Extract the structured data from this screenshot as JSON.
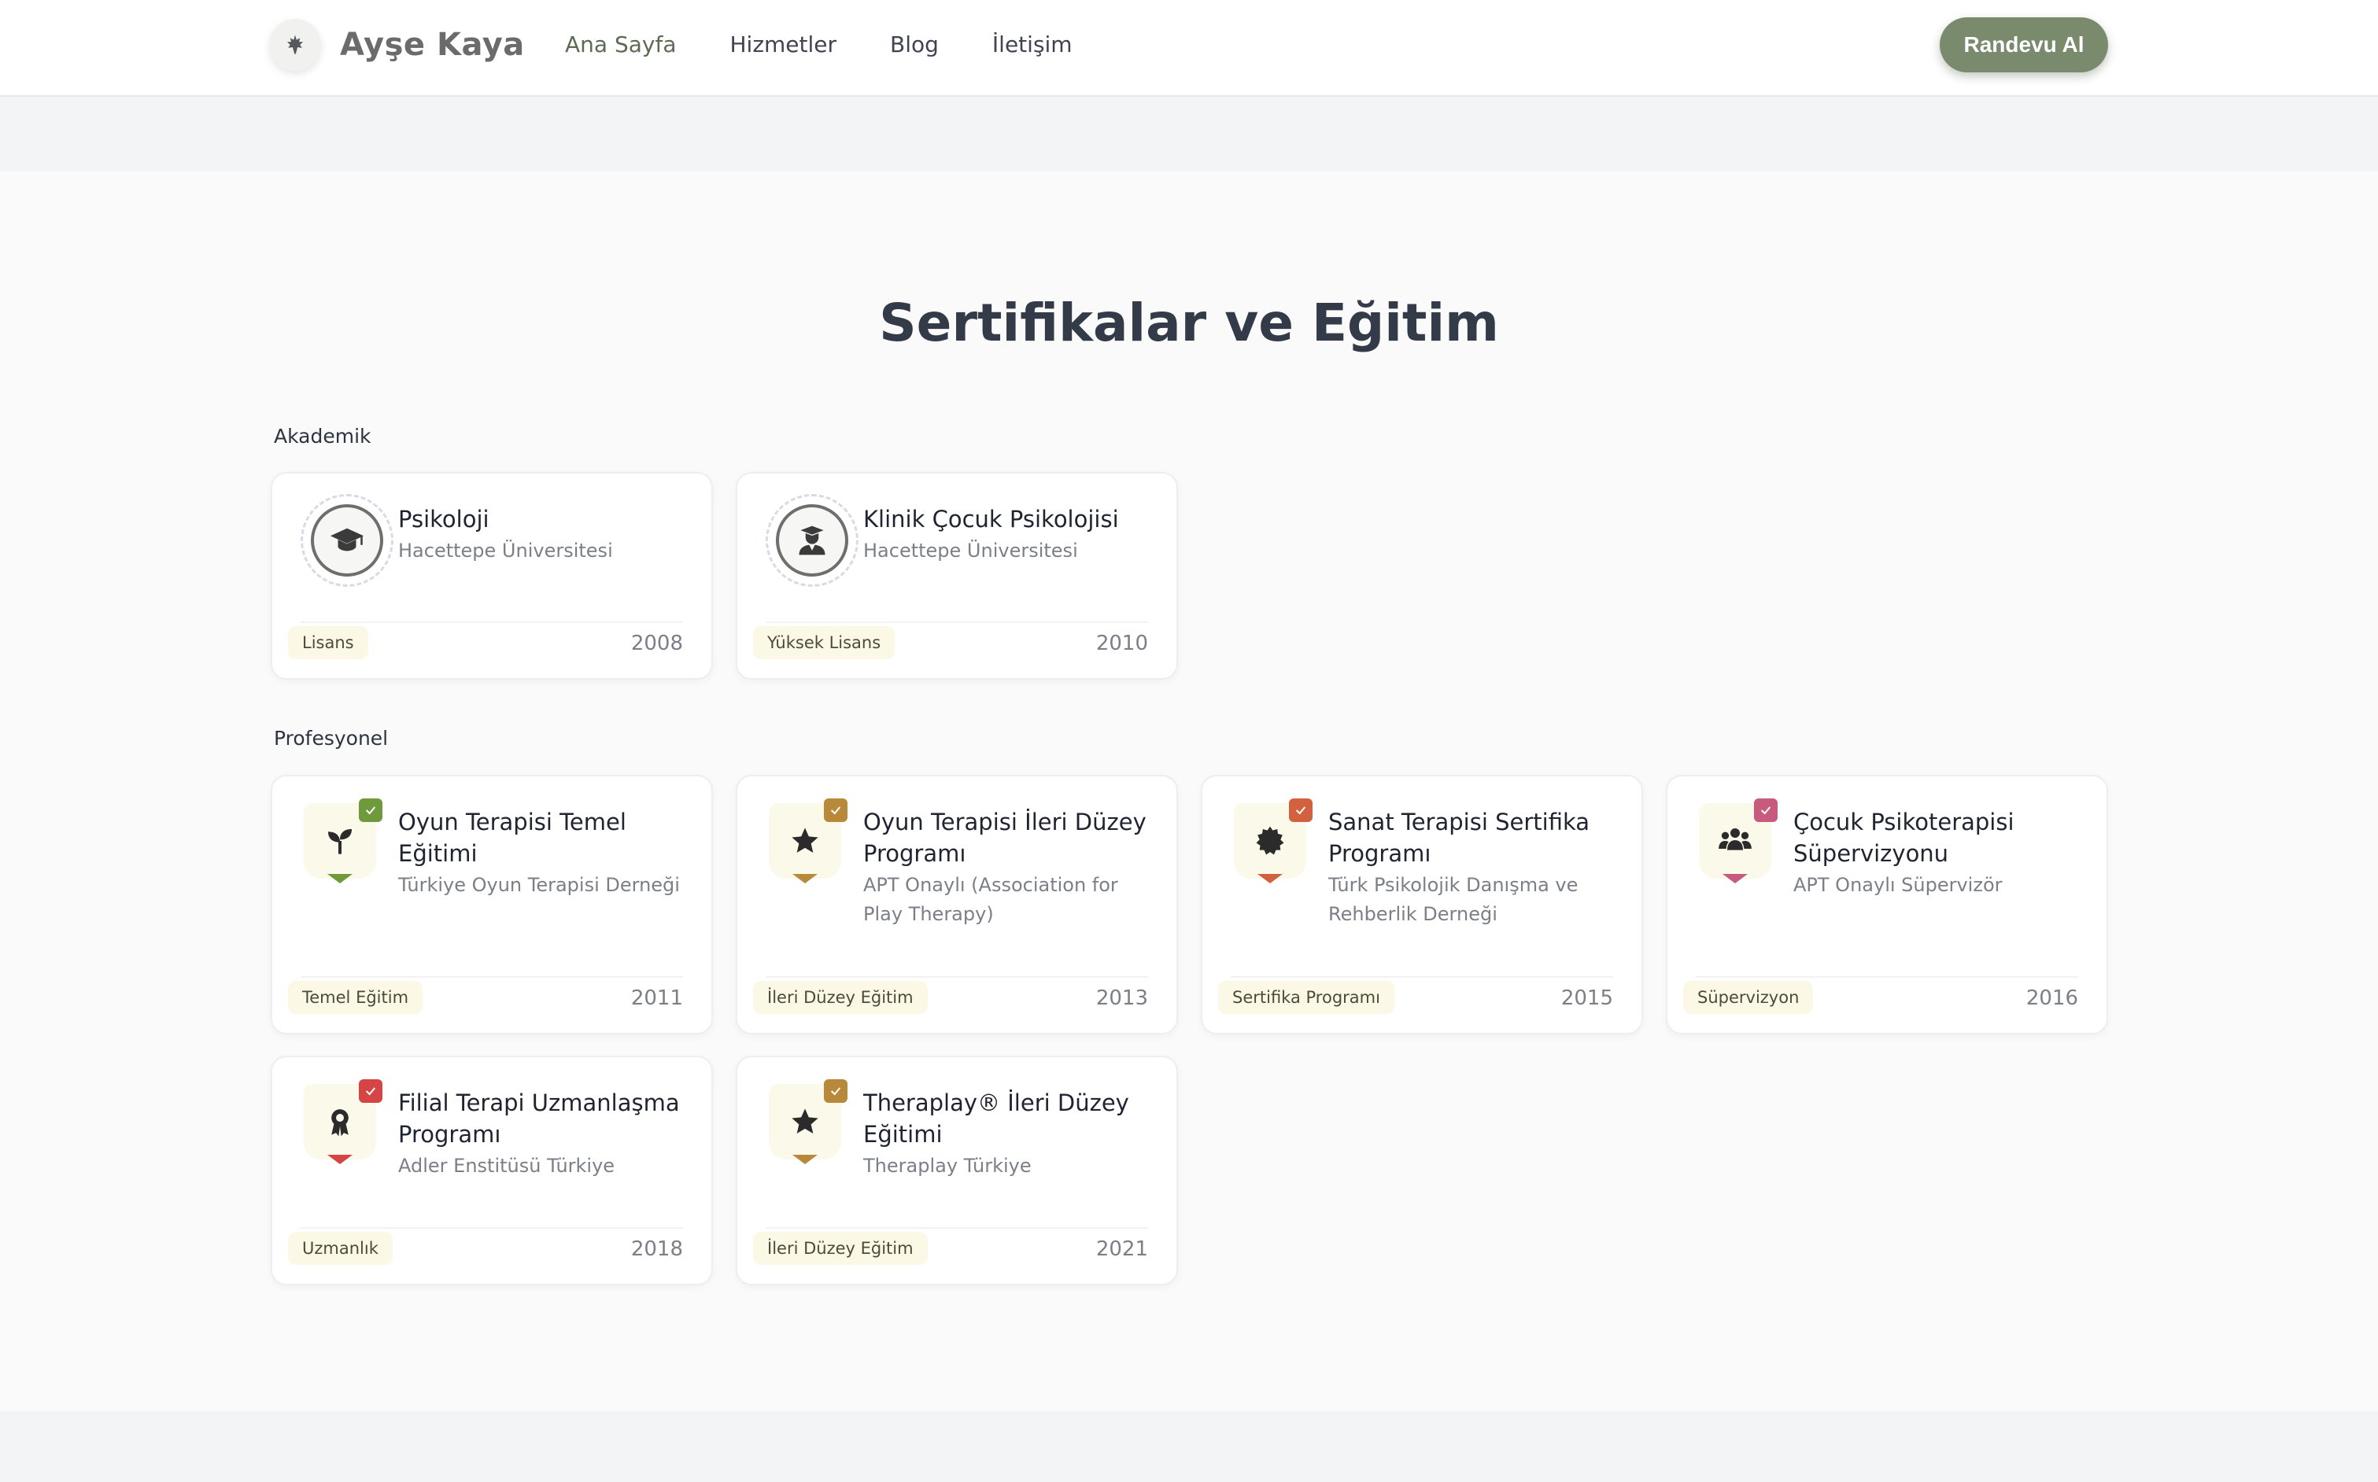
{
  "header": {
    "brand_name": "Ayşe Kaya",
    "nav": [
      "Ana Sayfa",
      "Hizmetler",
      "Blog",
      "İletişim"
    ],
    "cta_label": "Randevu Al",
    "logo_icon": "leaf-icon"
  },
  "section": {
    "title": "Sertifikalar ve Eğitim",
    "academic_label": "Akademik",
    "professional_label": "Profesyonel"
  },
  "academic": [
    {
      "title": "Psikoloji",
      "institution": "Hacettepe Üniversitesi",
      "tag": "Lisans",
      "year": "2008",
      "icon": "graduation-cap-icon"
    },
    {
      "title": "Klinik Çocuk Psikolojisi",
      "institution": "Hacettepe Üniversitesi",
      "tag": "Yüksek Lisans",
      "year": "2010",
      "icon": "graduate-user-icon"
    }
  ],
  "professional": [
    {
      "title": "Oyun Terapisi Temel Eğitimi",
      "institution": "Türkiye Oyun Terapisi Derneği",
      "tag": "Temel Eğitim",
      "year": "2011",
      "icon": "seedling-icon",
      "accent": "#6f9a3c"
    },
    {
      "title": "Oyun Terapisi İleri Düzey Programı",
      "institution": "APT Onaylı (Association for Play Therapy)",
      "tag": "İleri Düzey Eğitim",
      "year": "2013",
      "icon": "star-icon",
      "accent": "#b8893a"
    },
    {
      "title": "Sanat Terapisi Sertifika Programı",
      "institution": "Türk Psikolojik Danışma ve Rehberlik Derneği",
      "tag": "Sertifika Programı",
      "year": "2015",
      "icon": "seal-icon",
      "accent": "#d2613f"
    },
    {
      "title": "Çocuk Psikoterapisi Süpervizyonu",
      "institution": "APT Onaylı Süpervizör",
      "tag": "Süpervizyon",
      "year": "2016",
      "icon": "users-icon",
      "accent": "#c85a7e"
    },
    {
      "title": "Filial Terapi Uzmanlaşma Programı",
      "institution": "Adler Enstitüsü Türkiye",
      "tag": "Uzmanlık",
      "year": "2018",
      "icon": "award-icon",
      "accent": "#d64545"
    },
    {
      "title": "Theraplay® İleri Düzey Eğitimi",
      "institution": "Theraplay Türkiye",
      "tag": "İleri Düzey Eğitim",
      "year": "2021",
      "icon": "star-icon",
      "accent": "#b8893a"
    }
  ]
}
